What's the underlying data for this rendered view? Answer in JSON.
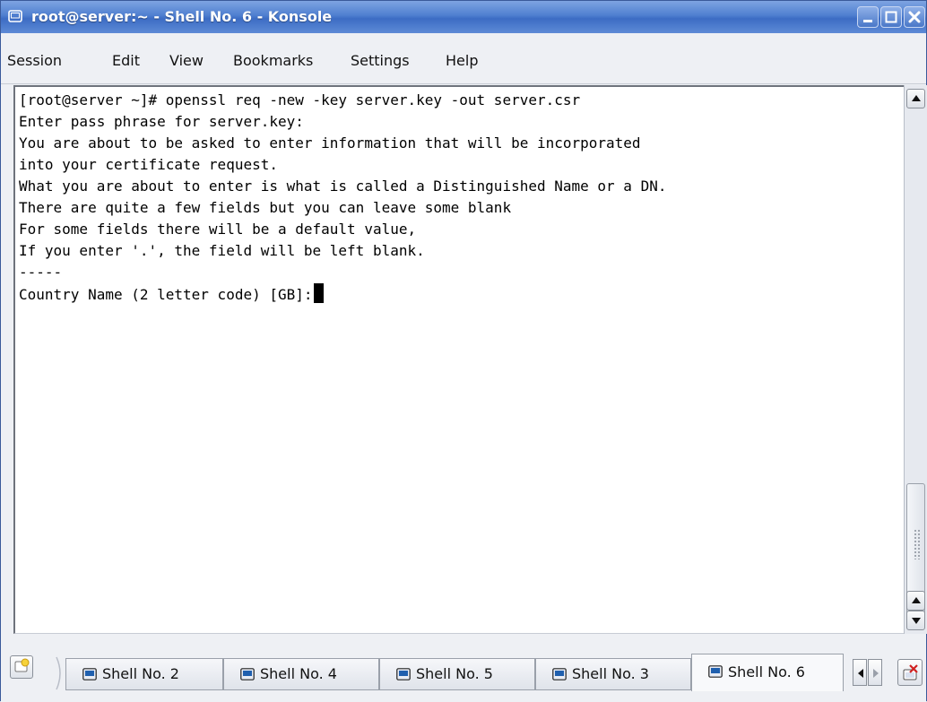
{
  "window": {
    "title": "root@server:~ - Shell No. 6 - Konsole"
  },
  "menu": {
    "items": [
      "Session",
      "Edit",
      "View",
      "Bookmarks",
      "Settings",
      "Help"
    ]
  },
  "terminal": {
    "lines": [
      "[root@server ~]# openssl req -new -key server.key -out server.csr",
      "Enter pass phrase for server.key:",
      "You are about to be asked to enter information that will be incorporated",
      "into your certificate request.",
      "What you are about to enter is what is called a Distinguished Name or a DN.",
      "There are quite a few fields but you can leave some blank",
      "For some fields there will be a default value,",
      "If you enter '.', the field will be left blank.",
      "-----",
      "Country Name (2 letter code) [GB]:"
    ]
  },
  "tabs": {
    "items": [
      "Shell No. 2",
      "Shell No. 4",
      "Shell No. 5",
      "Shell No. 3",
      "Shell No. 6"
    ],
    "active": "Shell No. 6"
  },
  "colors": {
    "titlebar": "#4f7fd0",
    "terminal_bg": "#ffffff",
    "terminal_fg": "#000000"
  },
  "icons": {
    "app": "terminal-icon",
    "minimize": "minimize-icon",
    "maximize": "maximize-icon",
    "close": "close-icon",
    "new_tab": "new-session-icon",
    "tab": "terminal-icon",
    "close_tab": "close-session-icon"
  }
}
